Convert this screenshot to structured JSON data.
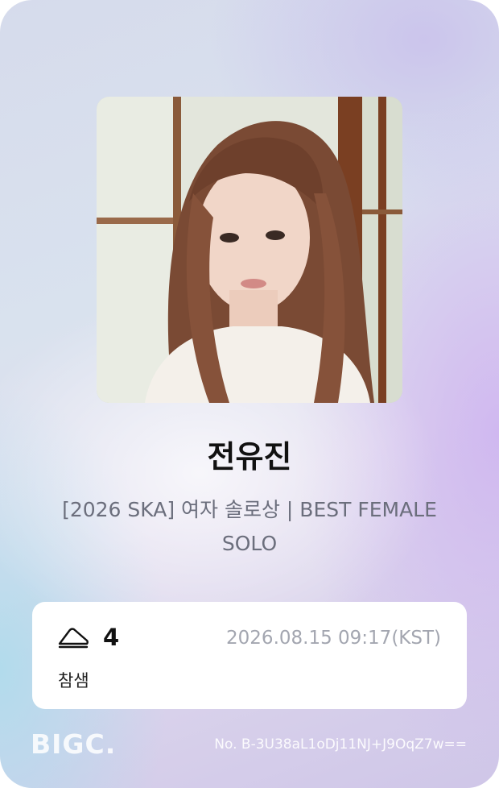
{
  "card": {
    "name": "전유진",
    "subtitle": "[2026 SKA] 여자 솔로상 | BEST FEMALE SOLO",
    "vote_count": "4",
    "datetime": "2026.08.15 09:17(KST)",
    "status": "참샘",
    "brand": "BIGC.",
    "serial": "No. B-3U38aL1oDj11NJ+J9OqZ7w=="
  },
  "icons": {
    "ticket": "ticket-icon"
  },
  "colors": {
    "accent_purple": "#cfc6e8",
    "accent_blue": "#aadcec",
    "text_dark": "#111111",
    "text_muted": "#6b6e7c",
    "text_light": "#a3a6b0"
  }
}
